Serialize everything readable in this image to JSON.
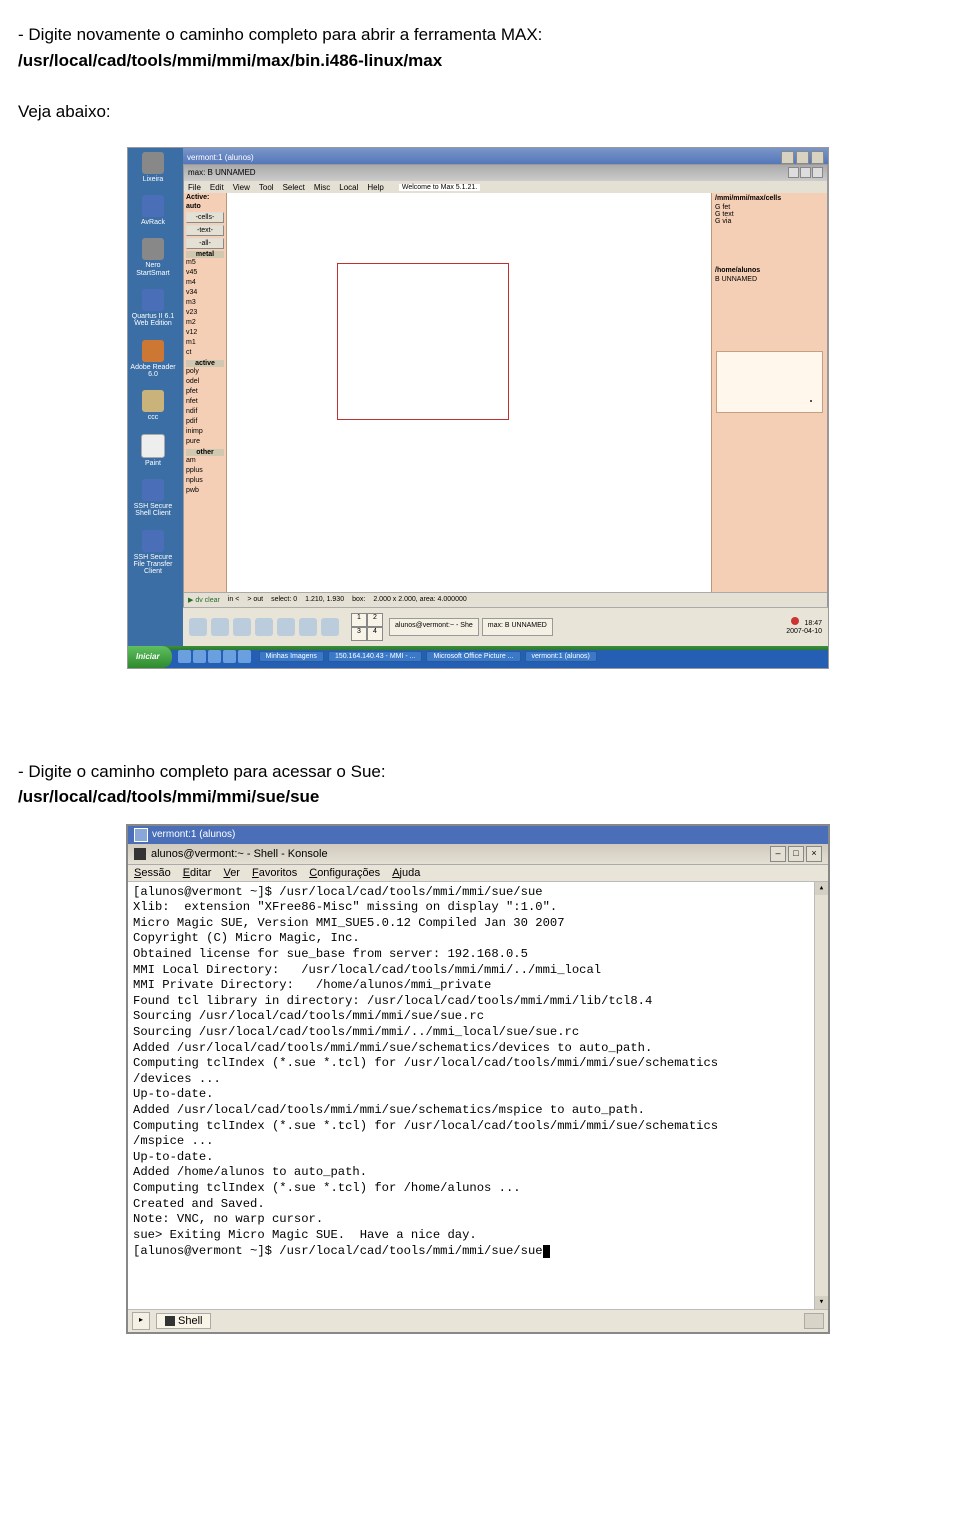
{
  "doc": {
    "line1": "- Digite novamente o caminho completo para abrir a ferramenta MAX:",
    "path1": "/usr/local/cad/tools/mmi/mmi/max/bin.i486-linux/max",
    "see_below": "Veja abaixo:",
    "line2": "- Digite o caminho completo para acessar o Sue:",
    "path2": "/usr/local/cad/tools/mmi/mmi/sue/sue"
  },
  "ss1": {
    "vnc_title": "vermont:1 (alunos)",
    "max_subtitle": "max: B  UNNAMED",
    "menus": [
      "File",
      "Edit",
      "View",
      "Tool",
      "Select",
      "Misc",
      "Local",
      "Help"
    ],
    "welcome": "Welcome to Max 5.1.21.",
    "left_header1": "Active:",
    "left_header2": "auto",
    "left_btns": [
      "-cells-",
      "-text-",
      "-all-"
    ],
    "left_metal_hdr": "metal",
    "left_metal": [
      "m5",
      "v45",
      "m4",
      "v34",
      "m3",
      "v23",
      "m2",
      "v12",
      "m1",
      "ct"
    ],
    "left_active_hdr": "active",
    "left_active": [
      "poly",
      "odel",
      "pfet",
      "nfet",
      "ndif",
      "pdif",
      "inimp",
      "pure"
    ],
    "left_other_hdr": "other",
    "left_other": [
      "am",
      "pplus",
      "nplus",
      "pwb"
    ],
    "right_path": "/mmi/mmi/max/cells",
    "right_items": [
      [
        "G",
        "fet"
      ],
      [
        "G",
        "text"
      ],
      [
        "G",
        "via"
      ]
    ],
    "right_home": "/home/alunos",
    "right_unnamed": "B   UNNAMED",
    "status": {
      "a": "dv clear",
      "b": "in <",
      "c": "> out",
      "d": "select: 0",
      "e": "1.210,   1.930",
      "f": "box:",
      "g": "2.000 x 2.000, area: 4.000000"
    },
    "kde_tasks": [
      "alunos@vermont:~ - She",
      "max: B  UNNAMED"
    ],
    "kde_pager": [
      "1",
      "2",
      "3",
      "4"
    ],
    "kde_clock_time": "18:47",
    "kde_clock_date": "2007-04-10",
    "desktop": [
      "Lixeira",
      "AvRack",
      "Nero StartSmart",
      "Quartus II 6.1 Web Edition",
      "Adobe Reader 6.0",
      "ccc",
      "Paint",
      "SSH Secure Shell Client",
      "SSH Secure File Transfer Client"
    ],
    "win_start": "Iniciar",
    "win_tasks": [
      "Minhas Imagens",
      "150.164.140.43 - MMI - ...",
      "Microsoft Office Picture ...",
      "vermont:1 (alunos)"
    ]
  },
  "ss2": {
    "vnc_title": "vermont:1 (alunos)",
    "window_title": "alunos@vermont:~ - Shell - Konsole",
    "menus": [
      "Sessão",
      "Editar",
      "Ver",
      "Favoritos",
      "Configurações",
      "Ajuda"
    ],
    "shell_tab": "Shell",
    "term_lines": [
      "[alunos@vermont ~]$ /usr/local/cad/tools/mmi/mmi/sue/sue",
      "Xlib:  extension \"XFree86-Misc\" missing on display \":1.0\".",
      "Micro Magic SUE, Version MMI_SUE5.0.12 Compiled Jan 30 2007",
      "Copyright (C) Micro Magic, Inc.",
      "Obtained license for sue_base from server: 192.168.0.5",
      "MMI Local Directory:   /usr/local/cad/tools/mmi/mmi/../mmi_local",
      "MMI Private Directory:   /home/alunos/mmi_private",
      "Found tcl library in directory: /usr/local/cad/tools/mmi/mmi/lib/tcl8.4",
      "Sourcing /usr/local/cad/tools/mmi/mmi/sue/sue.rc",
      "Sourcing /usr/local/cad/tools/mmi/mmi/../mmi_local/sue/sue.rc",
      "Added /usr/local/cad/tools/mmi/mmi/sue/schematics/devices to auto_path.",
      "Computing tclIndex (*.sue *.tcl) for /usr/local/cad/tools/mmi/mmi/sue/schematics",
      "/devices ...",
      "Up-to-date.",
      "Added /usr/local/cad/tools/mmi/mmi/sue/schematics/mspice to auto_path.",
      "Computing tclIndex (*.sue *.tcl) for /usr/local/cad/tools/mmi/mmi/sue/schematics",
      "/mspice ...",
      "Up-to-date.",
      "Added /home/alunos to auto_path.",
      "Computing tclIndex (*.sue *.tcl) for /home/alunos ...",
      "Created and Saved.",
      "Note: VNC, no warp cursor.",
      "sue> Exiting Micro Magic SUE.  Have a nice day.",
      "[alunos@vermont ~]$ /usr/local/cad/tools/mmi/mmi/sue/sue"
    ]
  }
}
